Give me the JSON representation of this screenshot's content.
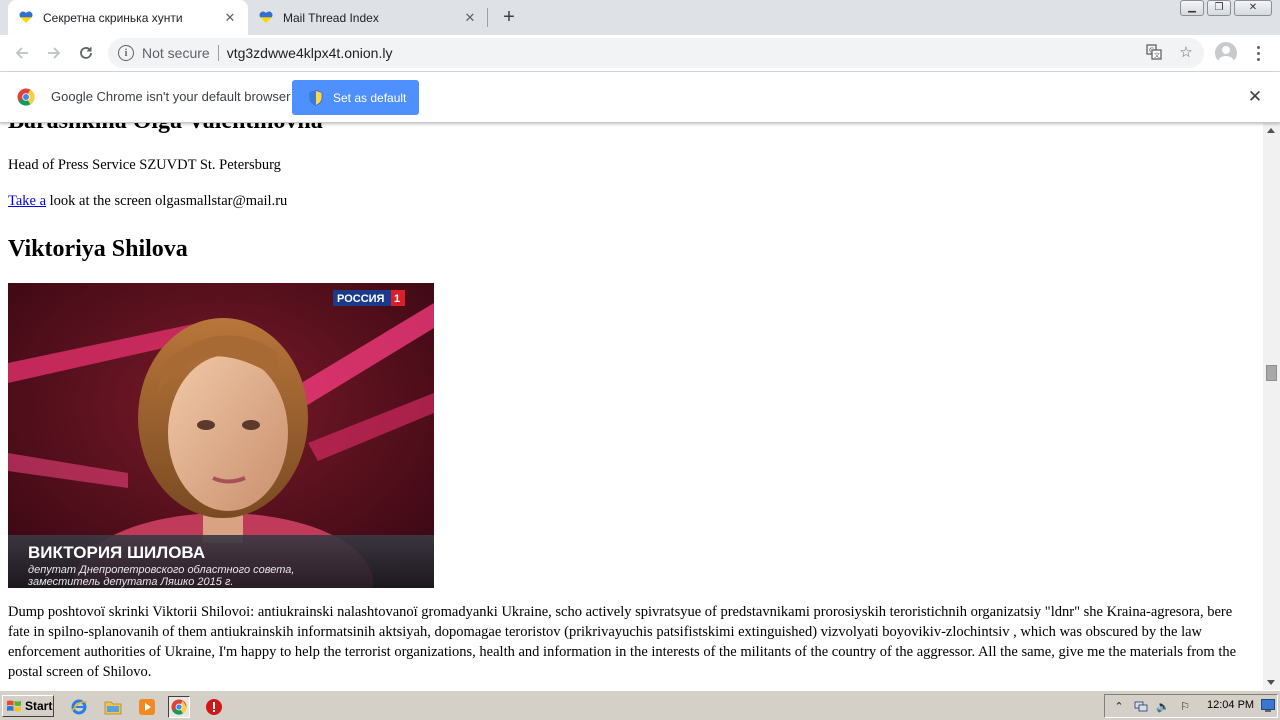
{
  "tabs": [
    {
      "title": "Секретна скринька хунти",
      "favicon": "ukraine-heart-icon",
      "active": true
    },
    {
      "title": "Mail Thread Index",
      "favicon": "ukraine-heart-icon",
      "active": false
    }
  ],
  "toolbar": {
    "security_label": "Not secure",
    "url": "vtg3zdwwe4klpx4t.onion.ly"
  },
  "infobar": {
    "message": "Google Chrome isn't your default browser",
    "button_label": "Set as default"
  },
  "content": {
    "heading1": "Barashkina Olga Valentinovna",
    "role": "Head of Press Service SZUVDT St. Petersburg",
    "link_text": "Take a",
    "link_rest": " look at the screen olgasmallstar@mail.ru",
    "heading2": "Viktoriya Shilova",
    "photo": {
      "logo": "РОССИЯ",
      "logo_num": "1",
      "caption_name": "ВИКТОРИЯ ШИЛОВА",
      "caption_sub": "депутат Днепропетровского областного совета,",
      "caption_sub2": "заместитель депутата Ляшко 2015 г."
    },
    "paragraph": "Dump poshtovoï skrinki Viktorii Shilovoi: antiukrainski nalashtovanoï gromadyanki Ukraine, scho actively spivratsyue of predstavnikami prorosiyskih teroristichnih organizatsiy \"ldnr\" she Kraina-agresora, bere fate in spilno-splanovanih of them antiukrainskih informatsinih aktsiyah, dopomagae teroristov (prikrivayuchis patsifistskimi extinguished) vizvolyati boyovikiv-zlochintsiv , which was obscured by the law enforcement authorities of Ukraine, I'm happy to help the terrorist organizations, health and information in the interests of the militants of the country of the aggressor. All the same, give me the materials from the postal screen of Shilovo."
  },
  "taskbar": {
    "start_label": "Start",
    "clock": "12:04 PM"
  },
  "colors": {
    "tabstrip": "#dee1e6",
    "accent_button": "#4d90fe",
    "link": "#0000ee",
    "taskbar": "#d4d0c8"
  }
}
